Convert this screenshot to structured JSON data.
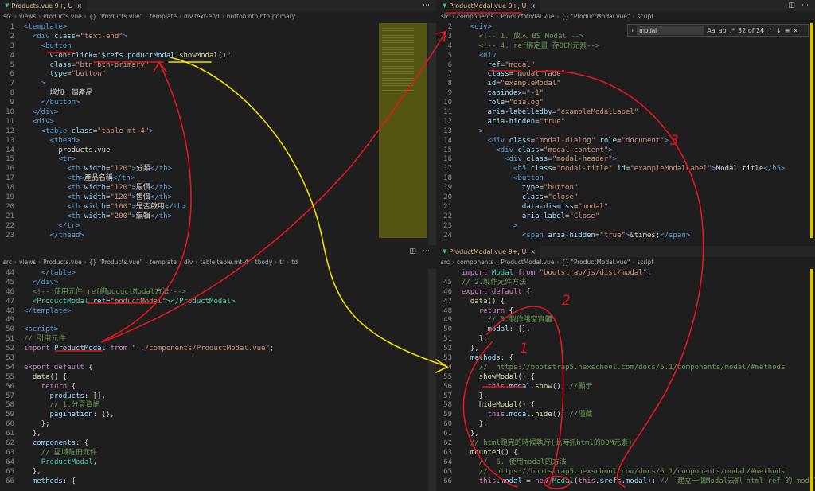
{
  "panes": [
    {
      "id": "tl",
      "tab": "Products.vue",
      "tab_status": "9+, U",
      "crumbs": [
        "src",
        "views",
        "Products.vue",
        "{} \"Products.vue\"",
        "template",
        "div.text-end",
        "button.btn.btn-primary"
      ],
      "lines": [
        {
          "n": "1",
          "html": "<span class='t-tag'>&lt;template&gt;</span>"
        },
        {
          "n": "2",
          "html": "  <span class='t-tag'>&lt;div</span> <span class='t-attr'>class</span>=<span class='t-str'>\"text-end\"</span><span class='t-tag'>&gt;</span>"
        },
        {
          "n": "3",
          "html": "    <span class='t-tag'>&lt;button</span>"
        },
        {
          "n": "4",
          "html": "      <span class='t-attr'>v-on:click</span>=<span class='t-str'>\"</span><span class='t-var'>$refs</span>.<span class='t-var'>poductModal</span>.<span class='t-fn'>showModal</span>()<span class='t-str'>\"</span>"
        },
        {
          "n": "5",
          "html": "      <span class='t-attr'>class</span>=<span class='t-str'>\"btn btn-primary\"</span>"
        },
        {
          "n": "6",
          "html": "      <span class='t-attr'>type</span>=<span class='t-str'>\"button\"</span>"
        },
        {
          "n": "7",
          "html": "    <span class='t-tag'>&gt;</span>"
        },
        {
          "n": "8",
          "html": "      增加一個產品"
        },
        {
          "n": "9",
          "html": "    <span class='t-tag'>&lt;/button&gt;</span>"
        },
        {
          "n": "10",
          "html": "  <span class='t-tag'>&lt;/div&gt;</span>"
        },
        {
          "n": "11",
          "html": "  <span class='t-tag'>&lt;div&gt;</span>"
        },
        {
          "n": "12",
          "html": "    <span class='t-tag'>&lt;table</span> <span class='t-attr'>class</span>=<span class='t-str'>\"table mt-4\"</span><span class='t-tag'>&gt;</span>"
        },
        {
          "n": "13",
          "html": "      <span class='t-tag'>&lt;thead&gt;</span>"
        },
        {
          "n": "14",
          "html": "        products.vue"
        },
        {
          "n": "15",
          "html": "        <span class='t-tag'>&lt;tr&gt;</span>"
        },
        {
          "n": "16",
          "html": "          <span class='t-tag'>&lt;th</span> <span class='t-attr'>width</span>=<span class='t-str'>\"120\"</span><span class='t-tag'>&gt;</span>分類<span class='t-tag'>&lt;/th&gt;</span>"
        },
        {
          "n": "17",
          "html": "          <span class='t-tag'>&lt;th&gt;</span>產品名稱<span class='t-tag'>&lt;/th&gt;</span>"
        },
        {
          "n": "18",
          "html": "          <span class='t-tag'>&lt;th</span> <span class='t-attr'>width</span>=<span class='t-str'>\"120\"</span><span class='t-tag'>&gt;</span>原價<span class='t-tag'>&lt;/th&gt;</span>"
        },
        {
          "n": "19",
          "html": "          <span class='t-tag'>&lt;th</span> <span class='t-attr'>width</span>=<span class='t-str'>\"120\"</span><span class='t-tag'>&gt;</span>售價<span class='t-tag'>&lt;/th&gt;</span>"
        },
        {
          "n": "20",
          "html": "          <span class='t-tag'>&lt;th</span> <span class='t-attr'>width</span>=<span class='t-str'>\"100\"</span><span class='t-tag'>&gt;</span>是否啟用<span class='t-tag'>&lt;/th&gt;</span>"
        },
        {
          "n": "21",
          "html": "          <span class='t-tag'>&lt;th</span> <span class='t-attr'>width</span>=<span class='t-str'>\"200\"</span><span class='t-tag'>&gt;</span>編輯<span class='t-tag'>&lt;/th&gt;</span>"
        },
        {
          "n": "22",
          "html": "        <span class='t-tag'>&lt;/tr&gt;</span>"
        },
        {
          "n": "23",
          "html": "      <span class='t-tag'>&lt;/thead&gt;</span>"
        }
      ]
    },
    {
      "id": "tr",
      "tab": "ProductModal.vue",
      "tab_status": "9+, U",
      "crumbs": [
        "src",
        "components",
        "ProductModal.vue",
        "{} \"ProductModal.vue\"",
        "script"
      ],
      "find": {
        "value": "modal",
        "count": "32 of 24",
        "opt_case": "Aa",
        "opt_word": "ab",
        "opt_regex": ".*"
      },
      "lines": [
        {
          "n": "2",
          "html": "  <span class='t-tag'>&lt;div&gt;</span>"
        },
        {
          "n": "3",
          "html": "    <span class='t-cm'>&lt;!-- 1. 放入 BS Modal --&gt;</span>"
        },
        {
          "n": "4",
          "html": "    <span class='t-cm'>&lt;!-- 4. ref綁定畫 存DOM元素--&gt;</span>"
        },
        {
          "n": "5",
          "html": "    <span class='t-tag'>&lt;div</span>"
        },
        {
          "n": "6",
          "html": "      <span class='t-attr'>ref</span>=<span class='t-str'>\"modal\"</span>"
        },
        {
          "n": "7",
          "html": "      <span class='t-attr'>class</span>=<span class='t-str'>\"modal fade\"</span>"
        },
        {
          "n": "8",
          "html": "      <span class='t-attr'>id</span>=<span class='t-str'>\"exampleModal\"</span>"
        },
        {
          "n": "9",
          "html": "      <span class='t-attr'>tabindex</span>=<span class='t-str'>\"-1\"</span>"
        },
        {
          "n": "10",
          "html": "      <span class='t-attr'>role</span>=<span class='t-str'>\"dialog\"</span>"
        },
        {
          "n": "11",
          "html": "      <span class='t-attr'>aria-labelledby</span>=<span class='t-str'>\"exampleModalLabel\"</span>"
        },
        {
          "n": "12",
          "html": "      <span class='t-attr'>aria-hidden</span>=<span class='t-str'>\"true\"</span>"
        },
        {
          "n": "13",
          "html": "    <span class='t-tag'>&gt;</span>"
        },
        {
          "n": "14",
          "html": "      <span class='t-tag'>&lt;div</span> <span class='t-attr'>class</span>=<span class='t-str'>\"modal-dialog\"</span> <span class='t-attr'>role</span>=<span class='t-str'>\"document\"</span><span class='t-tag'>&gt;</span>"
        },
        {
          "n": "15",
          "html": "        <span class='t-tag'>&lt;div</span> <span class='t-attr'>class</span>=<span class='t-str'>\"modal-content\"</span><span class='t-tag'>&gt;</span>"
        },
        {
          "n": "16",
          "html": "          <span class='t-tag'>&lt;div</span> <span class='t-attr'>class</span>=<span class='t-str'>\"modal-header\"</span><span class='t-tag'>&gt;</span>"
        },
        {
          "n": "17",
          "html": "            <span class='t-tag'>&lt;h5</span> <span class='t-attr'>class</span>=<span class='t-str'>\"modal-title\"</span> <span class='t-attr'>id</span>=<span class='t-str'>\"exampleModalLabel\"</span><span class='t-tag'>&gt;</span>Modal title<span class='t-tag'>&lt;/h5&gt;</span>"
        },
        {
          "n": "18",
          "html": "            <span class='t-tag'>&lt;button</span>"
        },
        {
          "n": "19",
          "html": "              <span class='t-attr'>type</span>=<span class='t-str'>\"button\"</span>"
        },
        {
          "n": "20",
          "html": "              <span class='t-attr'>class</span>=<span class='t-str'>\"close\"</span>"
        },
        {
          "n": "21",
          "html": "              <span class='t-attr'>data-dismiss</span>=<span class='t-str'>\"modal\"</span>"
        },
        {
          "n": "22",
          "html": "              <span class='t-attr'>aria-label</span>=<span class='t-str'>\"Close\"</span>"
        },
        {
          "n": "23",
          "html": "            <span class='t-tag'>&gt;</span>"
        },
        {
          "n": "24",
          "html": "              <span class='t-tag'>&lt;span</span> <span class='t-attr'>aria-hidden</span>=<span class='t-str'>\"true\"</span><span class='t-tag'>&gt;</span>&amp;times;<span class='t-tag'>&lt;/span&gt;</span>"
        }
      ]
    },
    {
      "id": "bl",
      "tab": "Products.vue",
      "tab_status": "9+, U",
      "crumbs": [
        "src",
        "views",
        "Products.vue",
        "{} \"Products.vue\"",
        "template",
        "div",
        "table.table.mt-4",
        "tbody",
        "tr",
        "td"
      ],
      "lines": [
        {
          "n": "44",
          "html": "    <span class='t-tag'>&lt;/table&gt;</span>"
        },
        {
          "n": "45",
          "html": "  <span class='t-tag'>&lt;/div&gt;</span>"
        },
        {
          "n": "46",
          "html": "  <span class='t-cm'>&lt;!-- 使用元件 ref綁poductModal方法 --&gt;</span>"
        },
        {
          "n": "47",
          "html": "  <span class='t-cls'>&lt;ProductModal</span> <span class='t-attr'>ref</span>=<span class='t-str'>\"poductModal\"</span><span class='t-cls'>&gt;&lt;/ProductModal&gt;</span>"
        },
        {
          "n": "48",
          "html": "<span class='t-tag'>&lt;/template&gt;</span>"
        },
        {
          "n": "49",
          "html": ""
        },
        {
          "n": "50",
          "html": "<span class='t-tag'>&lt;script&gt;</span>"
        },
        {
          "n": "51",
          "html": "<span class='t-cm'>// 引用元件</span>"
        },
        {
          "n": "52",
          "html": "<span class='t-kw'>import</span> <span class='t-var'>ProductModal</span> <span class='t-kw'>from</span> <span class='t-str'>\"../components/ProductModal.vue\"</span>;"
        },
        {
          "n": "53",
          "html": ""
        },
        {
          "n": "54",
          "html": "<span class='t-kw'>export default</span> {"
        },
        {
          "n": "55",
          "html": "  <span class='t-fn'>data</span>() {"
        },
        {
          "n": "56",
          "html": "    <span class='t-kw'>return</span> {"
        },
        {
          "n": "57",
          "html": "      <span class='t-var'>products</span>: [],"
        },
        {
          "n": "58",
          "html": "      <span class='t-cm'>// 1.分頁資訊</span>"
        },
        {
          "n": "59",
          "html": "      <span class='t-var'>pagination</span>: {},"
        },
        {
          "n": "60",
          "html": "    };"
        },
        {
          "n": "61",
          "html": "  },"
        },
        {
          "n": "62",
          "html": "  <span class='t-var'>components</span>: {"
        },
        {
          "n": "63",
          "html": "    <span class='t-cm'>// 區域註冊元件</span>"
        },
        {
          "n": "64",
          "html": "    <span class='t-cls'>ProductModal</span>,"
        },
        {
          "n": "65",
          "html": "  },"
        },
        {
          "n": "66",
          "html": "  <span class='t-var'>methods</span>: {"
        }
      ]
    },
    {
      "id": "br",
      "tab": "ProductModal.vue",
      "tab_status": "9+, U",
      "crumbs": [
        "src",
        "components",
        "ProductModal.vue",
        "{} \"ProductModal.vue\"",
        "script"
      ],
      "lines": [
        {
          "n": "",
          "html": "<span class='t-kw'>import</span> <span class='t-cls'>Modal</span> <span class='t-kw'>from</span> <span class='t-str'>\"bootstrap/js/dist/modal\"</span>;"
        },
        {
          "n": "45",
          "html": "<span class='t-cm'>// 2.製作元件方法</span>"
        },
        {
          "n": "46",
          "html": "<span class='t-kw'>export default</span> {"
        },
        {
          "n": "47",
          "html": "  <span class='t-fn'>data</span>() {"
        },
        {
          "n": "48",
          "html": "    <span class='t-kw'>return</span> {"
        },
        {
          "n": "49",
          "html": "      <span class='t-cm'>// 3.製作跳窗實體</span>"
        },
        {
          "n": "50",
          "html": "      <span class='t-var'>modal</span>: {},"
        },
        {
          "n": "51",
          "html": "    };"
        },
        {
          "n": "52",
          "html": "  },"
        },
        {
          "n": "53",
          "html": "  <span class='t-var'>methods</span>: {"
        },
        {
          "n": "54",
          "html": "    <span class='t-cm'>//  https://bootstrap5.hexschool.com/docs/5.1/components/modal/#methods</span>"
        },
        {
          "n": "55",
          "html": "    <span class='t-fn'>showModal</span>() {"
        },
        {
          "n": "56",
          "html": "      <span class='t-kw'>this</span>.<span class='t-var'>modal</span>.<span class='t-fn'>show</span>(); <span class='t-cm'>//顯示</span>"
        },
        {
          "n": "57",
          "html": "    },"
        },
        {
          "n": "58",
          "html": "    <span class='t-fn'>hideModal</span>() {"
        },
        {
          "n": "59",
          "html": "      <span class='t-kw'>this</span>.<span class='t-var'>modal</span>.<span class='t-fn'>hide</span>(); <span class='t-cm'>//隱藏</span>"
        },
        {
          "n": "60",
          "html": "    },"
        },
        {
          "n": "61",
          "html": "  },"
        },
        {
          "n": "62",
          "html": "  <span class='t-cm'>// html跑完的時候執行(此時抓html的DOM元素)</span>"
        },
        {
          "n": "63",
          "html": "  <span class='t-fn'>mounted</span>() {"
        },
        {
          "n": "64",
          "html": "    <span class='t-cm'>//  6. 使用modal的方法</span>"
        },
        {
          "n": "65",
          "html": "    <span class='t-cm'>//  https://bootstrap5.hexschool.com/docs/5.1/components/modal/#methods</span>"
        },
        {
          "n": "66",
          "html": "    <span class='t-kw'>this</span>.<span class='t-var'>modal</span> = <span class='t-kw'>new</span> <span class='t-cls'>Modal</span>(<span class='t-kw'>this</span>.<span class='t-var'>$refs</span>.<span class='t-var'>modal</span>); <span class='t-cm'>//  建立一個Modal去抓 html ref 的 modal</span>"
        }
      ]
    }
  ],
  "annotations": {
    "n1": "1",
    "n2": "2",
    "n3": "3"
  },
  "colors": {
    "annot_red": "#e0171f",
    "annot_yellow": "#f2de00",
    "tab_modified": "#e2c08d",
    "vue_icon": "#41b883"
  },
  "icons": {
    "vue": "vue-icon",
    "close": "close-icon",
    "split": "split-editor-icon",
    "more": "more-actions-icon",
    "up": "arrow-up-icon",
    "down": "arrow-down-icon",
    "menu": "hamburger-icon",
    "closefind": "close-icon"
  }
}
